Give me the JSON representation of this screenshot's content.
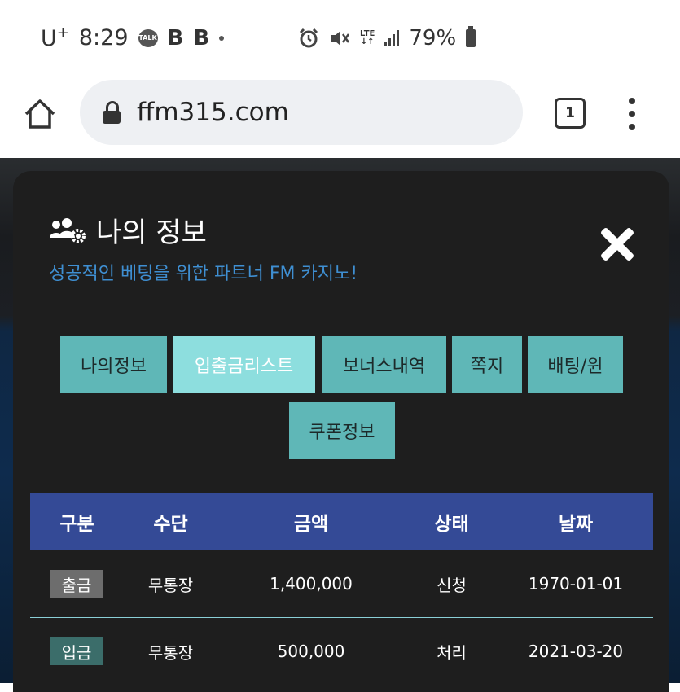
{
  "status_bar": {
    "carrier": "U",
    "carrier_sup": "+",
    "time": "8:29",
    "talk_icon": "TALK",
    "b1": "B",
    "b2": "B",
    "lte": "LTE",
    "battery": "79%"
  },
  "browser": {
    "url": "ffm315.com",
    "tab_count": "1"
  },
  "modal": {
    "title": "나의 정보",
    "subtitle": "성공적인 베팅을 위한 파트너 FM 카지노!",
    "tabs": [
      {
        "label": "나의정보"
      },
      {
        "label": "입출금리스트"
      },
      {
        "label": "보너스내역"
      },
      {
        "label": "쪽지"
      },
      {
        "label": "배팅/윈"
      },
      {
        "label": "쿠폰정보"
      }
    ],
    "active_tab": "입출금리스트"
  },
  "table": {
    "headers": [
      "구분",
      "수단",
      "금액",
      "상태",
      "날짜"
    ],
    "rows": [
      {
        "type": "출금",
        "method": "무통장",
        "amount": "1,400,000",
        "status": "신청",
        "date": "1970-01-01"
      },
      {
        "type": "입금",
        "method": "무통장",
        "amount": "500,000",
        "status": "처리",
        "date": "2021-03-20"
      }
    ]
  },
  "colors": {
    "accent": "#5fb7b7",
    "active_tab": "#8ddede",
    "table_header": "#344a96",
    "subtitle": "#3f8fd2"
  }
}
